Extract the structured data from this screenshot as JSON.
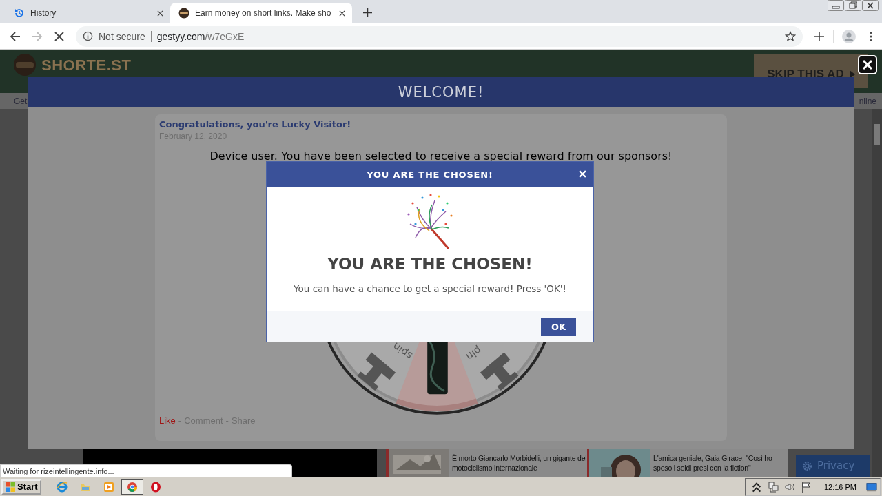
{
  "browser": {
    "tabs": [
      {
        "title": "History",
        "selected": false
      },
      {
        "title": "Earn money on short links. Make sho",
        "selected": true
      }
    ],
    "forward_disabled": true,
    "loading": true,
    "address_bar": {
      "security": "Not secure",
      "host": "gestyy.com",
      "path": "/w7eGxE"
    }
  },
  "site_header": {
    "logo": "SHORTE.ST",
    "skip_button": "SKIP THIS AD"
  },
  "links": [
    "Get",
    "nline"
  ],
  "welcome_modal": {
    "title": "WELCOME!",
    "post": {
      "author": "Congratulations, you're Lucky Visitor!",
      "date": "February 12, 2020",
      "message": "Device user. You have been selected to receive a special reward from our sponsors!",
      "wheel_labels": [
        "spin",
        "pin"
      ],
      "separator": "-",
      "actions": [
        {
          "label": "Like",
          "active": true
        },
        {
          "label": "Comment",
          "active": false
        },
        {
          "label": "Share",
          "active": false
        }
      ]
    }
  },
  "news": [
    {
      "headline": "È morto Giancarlo Morbidelli, un gigante del motociclismo internazionale"
    },
    {
      "headline": "L'amica geniale, Gaia Girace: \"Così ho speso i soldi presi con la fiction\""
    }
  ],
  "privacy_button": "Privacy",
  "status_text": "Waiting for rizeintellingente.info...",
  "dialog": {
    "title": "YOU ARE THE CHOSEN!",
    "heading": "YOU ARE THE CHOSEN!",
    "text": "You can have a chance to get a special reward! Press 'OK'!",
    "button": "OK"
  },
  "taskbar": {
    "start": "Start",
    "apps": [
      {
        "kind": "ie",
        "active": false
      },
      {
        "kind": "folder",
        "active": false
      },
      {
        "kind": "media",
        "active": false
      },
      {
        "kind": "chrome",
        "active": true
      },
      {
        "kind": "opera",
        "active": false
      }
    ],
    "time": "12:16 PM"
  }
}
